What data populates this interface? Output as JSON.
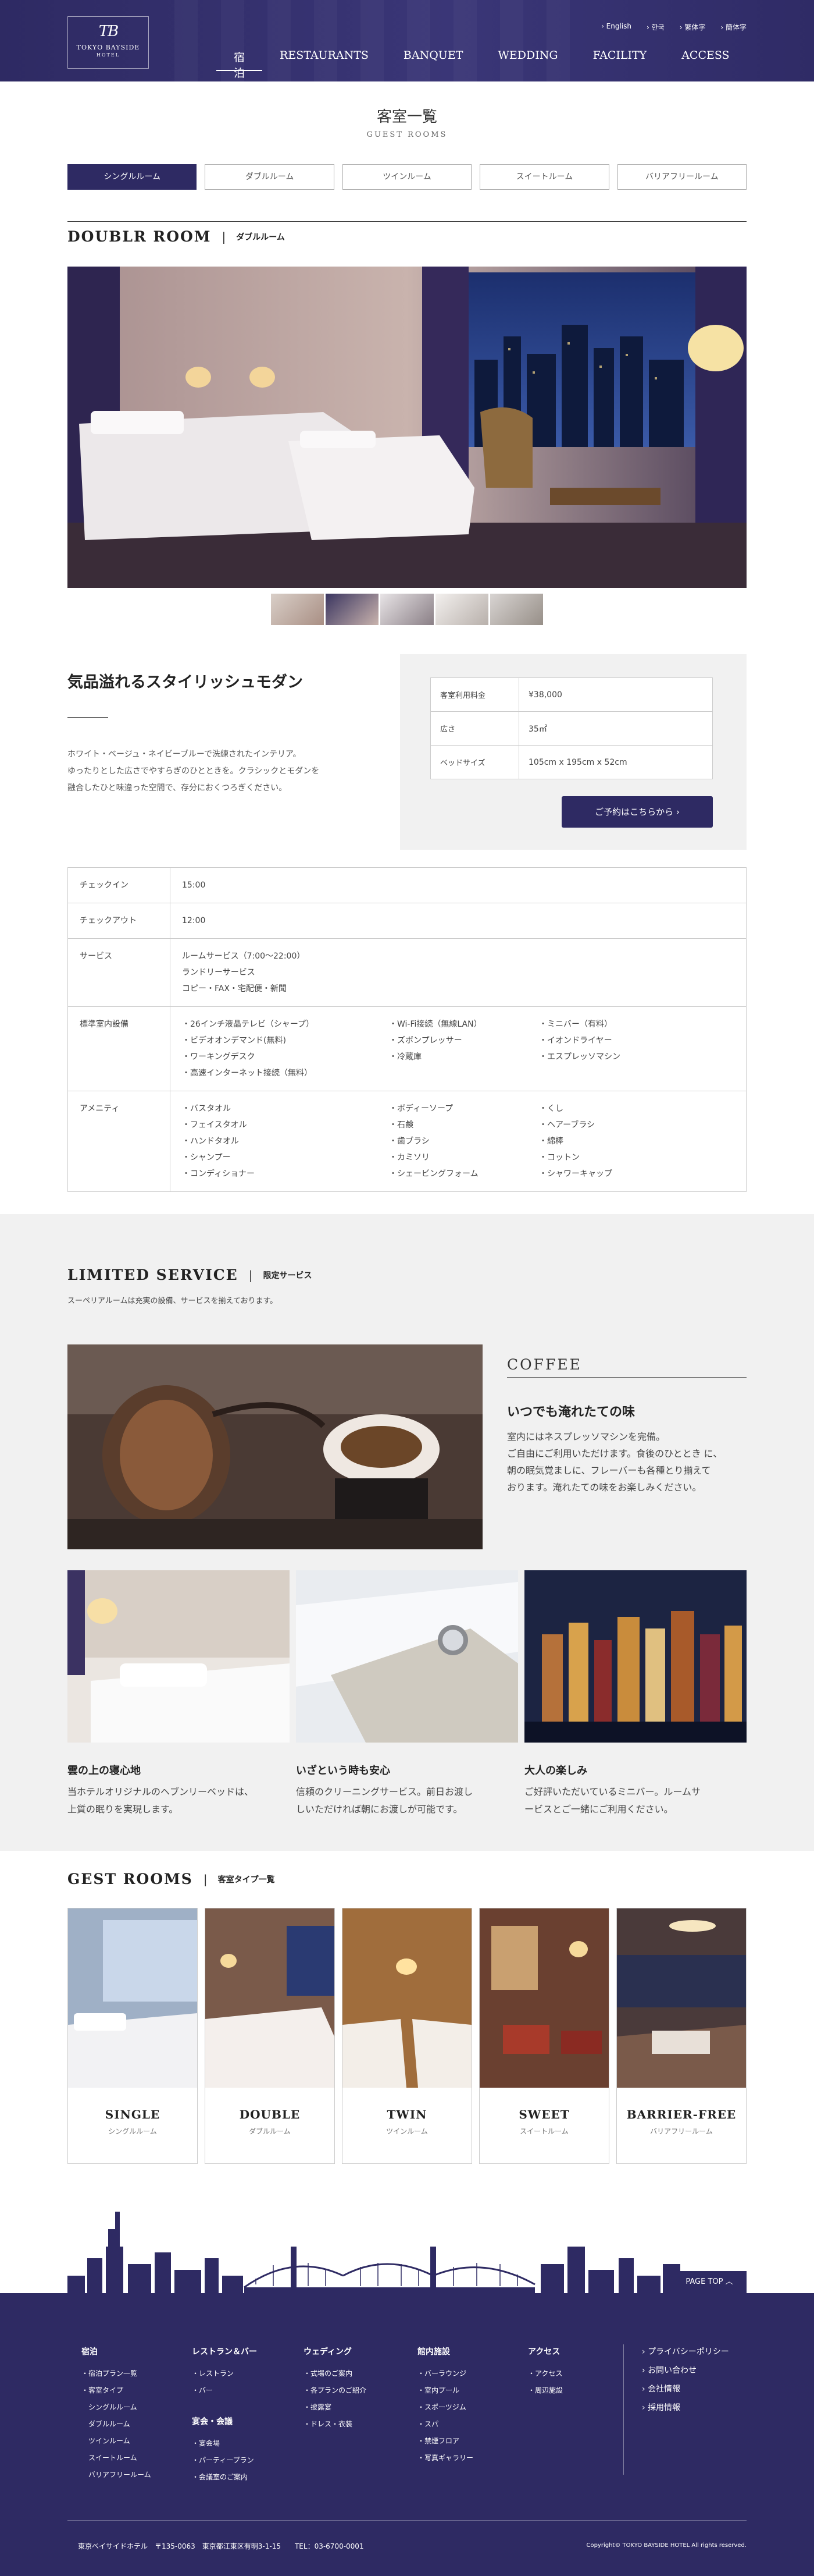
{
  "header": {
    "logo_mark": "TB",
    "logo_name": "TOKYO BAYSIDE",
    "logo_sub": "HOTEL",
    "languages": [
      "English",
      "한국",
      "繁体字",
      "簡体字"
    ],
    "nav": [
      "宿泊",
      "RESTAURANTS",
      "BANQUET",
      "WEDDING",
      "FACILITY",
      "ACCESS"
    ],
    "nav_active": "宿泊"
  },
  "page": {
    "title": "客室一覧",
    "subtitle": "GUEST ROOMS"
  },
  "room_tabs": [
    "シングルルーム",
    "ダブルルーム",
    "ツインルーム",
    "スイートルーム",
    "バリアフリールーム"
  ],
  "room_tab_active": "シングルルーム",
  "room": {
    "heading_en": "DOUBLR ROOM",
    "heading_sep": "|",
    "heading_jp": "ダブルルーム",
    "catch": "気品溢れるスタイリッシュモダン",
    "description": [
      "ホワイト・ベージュ・ネイビーブルーで洗練されたインテリア。",
      "ゆったりとした広さでやすらぎのひとときを。クラシックとモダンを",
      "融合したひと味違った空間で、存分におくつろぎください。"
    ],
    "price_table": [
      {
        "label": "客室利用料金",
        "value": "¥38,000"
      },
      {
        "label": "広さ",
        "value": "35㎡"
      },
      {
        "label": "ベッドサイズ",
        "value": "105cm x 195cm x 52cm"
      }
    ],
    "reserve_button": "ご予約はこちらから ›"
  },
  "info": {
    "checkin_label": "チェックイン",
    "checkin": "15:00",
    "checkout_label": "チェックアウト",
    "checkout": "12:00",
    "service_label": "サービス",
    "service": [
      "ルームサービス（7:00〜22:00）",
      "ランドリーサービス",
      "コピー・FAX・宅配便・新聞"
    ],
    "equipment_label": "標準室内設備",
    "equipment": [
      [
        "26インチ液晶テレビ（シャープ）",
        "ビデオオンデマンド(無料)",
        "ワーキングデスク",
        "高速インターネット接続（無料）"
      ],
      [
        "Wi-Fi接続（無線LAN）",
        "ズボンプレッサー",
        "冷蔵庫"
      ],
      [
        "ミニバー（有料）",
        "イオンドライヤー",
        "エスプレッソマシン"
      ]
    ],
    "amenity_label": "アメニティ",
    "amenity": [
      [
        "バスタオル",
        "フェイスタオル",
        "ハンドタオル",
        "シャンプー",
        "コンディショナー"
      ],
      [
        "ボディーソープ",
        "石鹸",
        "歯ブラシ",
        "カミソリ",
        "シェービングフォーム"
      ],
      [
        "くし",
        "ヘアーブラシ",
        "綿棒",
        "コットン",
        "シャワーキャップ"
      ]
    ]
  },
  "limited": {
    "heading_en": "LIMITED SERVICE",
    "heading_sep": "|",
    "heading_jp": "限定サービス",
    "description": "スーペリアルームは充実の設備、サービスを揃えております。",
    "coffee_label": "COFFEE",
    "coffee_title": "いつでも淹れたての味",
    "coffee_desc": [
      "室内にはネスプレッソマシンを完備。",
      "ご自由にご利用いただけます。食後のひととき に、",
      "朝の眠気覚ましに、フレーバーも各種とり揃えて",
      "おります。淹れたての味をお楽しみください。"
    ],
    "features": [
      {
        "title": "雲の上の寝心地",
        "desc": [
          "当ホテルオリジナルのヘブンリーベッドは、",
          "上質の眠りを実現します。"
        ]
      },
      {
        "title": "いざという時も安心",
        "desc": [
          "信頼のクリーニングサービス。前日お渡し",
          "しいただければ朝にお渡しが可能です。"
        ]
      },
      {
        "title": "大人の楽しみ",
        "desc": [
          "ご好評いただいているミニバー。ルームサ",
          "ービスとご一緒にご利用ください。"
        ]
      }
    ]
  },
  "gest": {
    "heading_en": "GEST ROOMS",
    "heading_sep": "|",
    "heading_jp": "客室タイプ一覧",
    "rooms": [
      {
        "en": "SINGLE",
        "jp": "シングルルーム"
      },
      {
        "en": "DOUBLE",
        "jp": "ダブルルーム"
      },
      {
        "en": "TWIN",
        "jp": "ツインルーム"
      },
      {
        "en": "SWEET",
        "jp": "スイートルーム"
      },
      {
        "en": "BARRIER-FREE",
        "jp": "バリアフリールーム"
      }
    ]
  },
  "footer": {
    "page_top": "PAGE TOP ︿",
    "col1_head": "宿泊",
    "col1": [
      "宿泊プラン一覧",
      "客室タイプ",
      "シングルルーム",
      "ダブルルーム",
      "ツインルーム",
      "スイートルーム",
      "バリアフリールーム"
    ],
    "col2_head": "レストラン＆バー",
    "col2": [
      "レストラン",
      "バー"
    ],
    "col2b_head": "宴会・会議",
    "col2b": [
      "宴会場",
      "パーティープラン",
      "会議室のご案内"
    ],
    "col3_head": "ウェディング",
    "col3": [
      "式場のご案内",
      "各プランのご紹介",
      "披露宴",
      "ドレス・衣装"
    ],
    "col4_head": "館内施設",
    "col4": [
      "バーラウンジ",
      "室内プール",
      "スポーツジム",
      "スパ",
      "禁煙フロア",
      "写真ギャラリー"
    ],
    "col5_head": "アクセス",
    "col5": [
      "アクセス",
      "周辺施設"
    ],
    "links": [
      "プライバシーポリシー",
      "お問い合わせ",
      "会社情報",
      "採用情報"
    ],
    "address": "東京ベイサイドホテル　〒135-0063　東京都江東区有明3-1-15　　TEL：03-6700-0001",
    "copyright": "Copyright© TOKYO BAYSIDE HOTEL All rights reserved."
  },
  "colors": {
    "brand": "#2e2a63",
    "panel": "#f1f1f1"
  }
}
